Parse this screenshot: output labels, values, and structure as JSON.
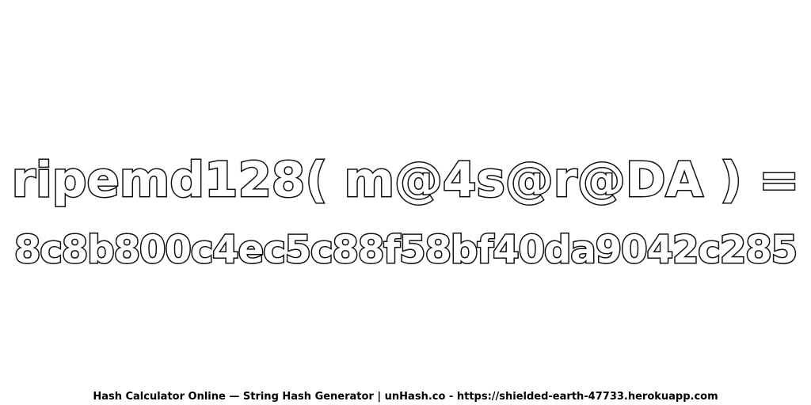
{
  "headline": {
    "text": "ripemd128( m@4s@r@DA ) ="
  },
  "hash": {
    "text": "8c8b800c4ec5c88f58bf40da9042c285"
  },
  "footer": {
    "text": "Hash Calculator Online — String Hash Generator | unHash.co - https://shielded-earth-47733.herokuapp.com"
  },
  "colors": {
    "background": "#ffffff",
    "text_fill": "#ffffff",
    "text_outline": "#111111"
  }
}
